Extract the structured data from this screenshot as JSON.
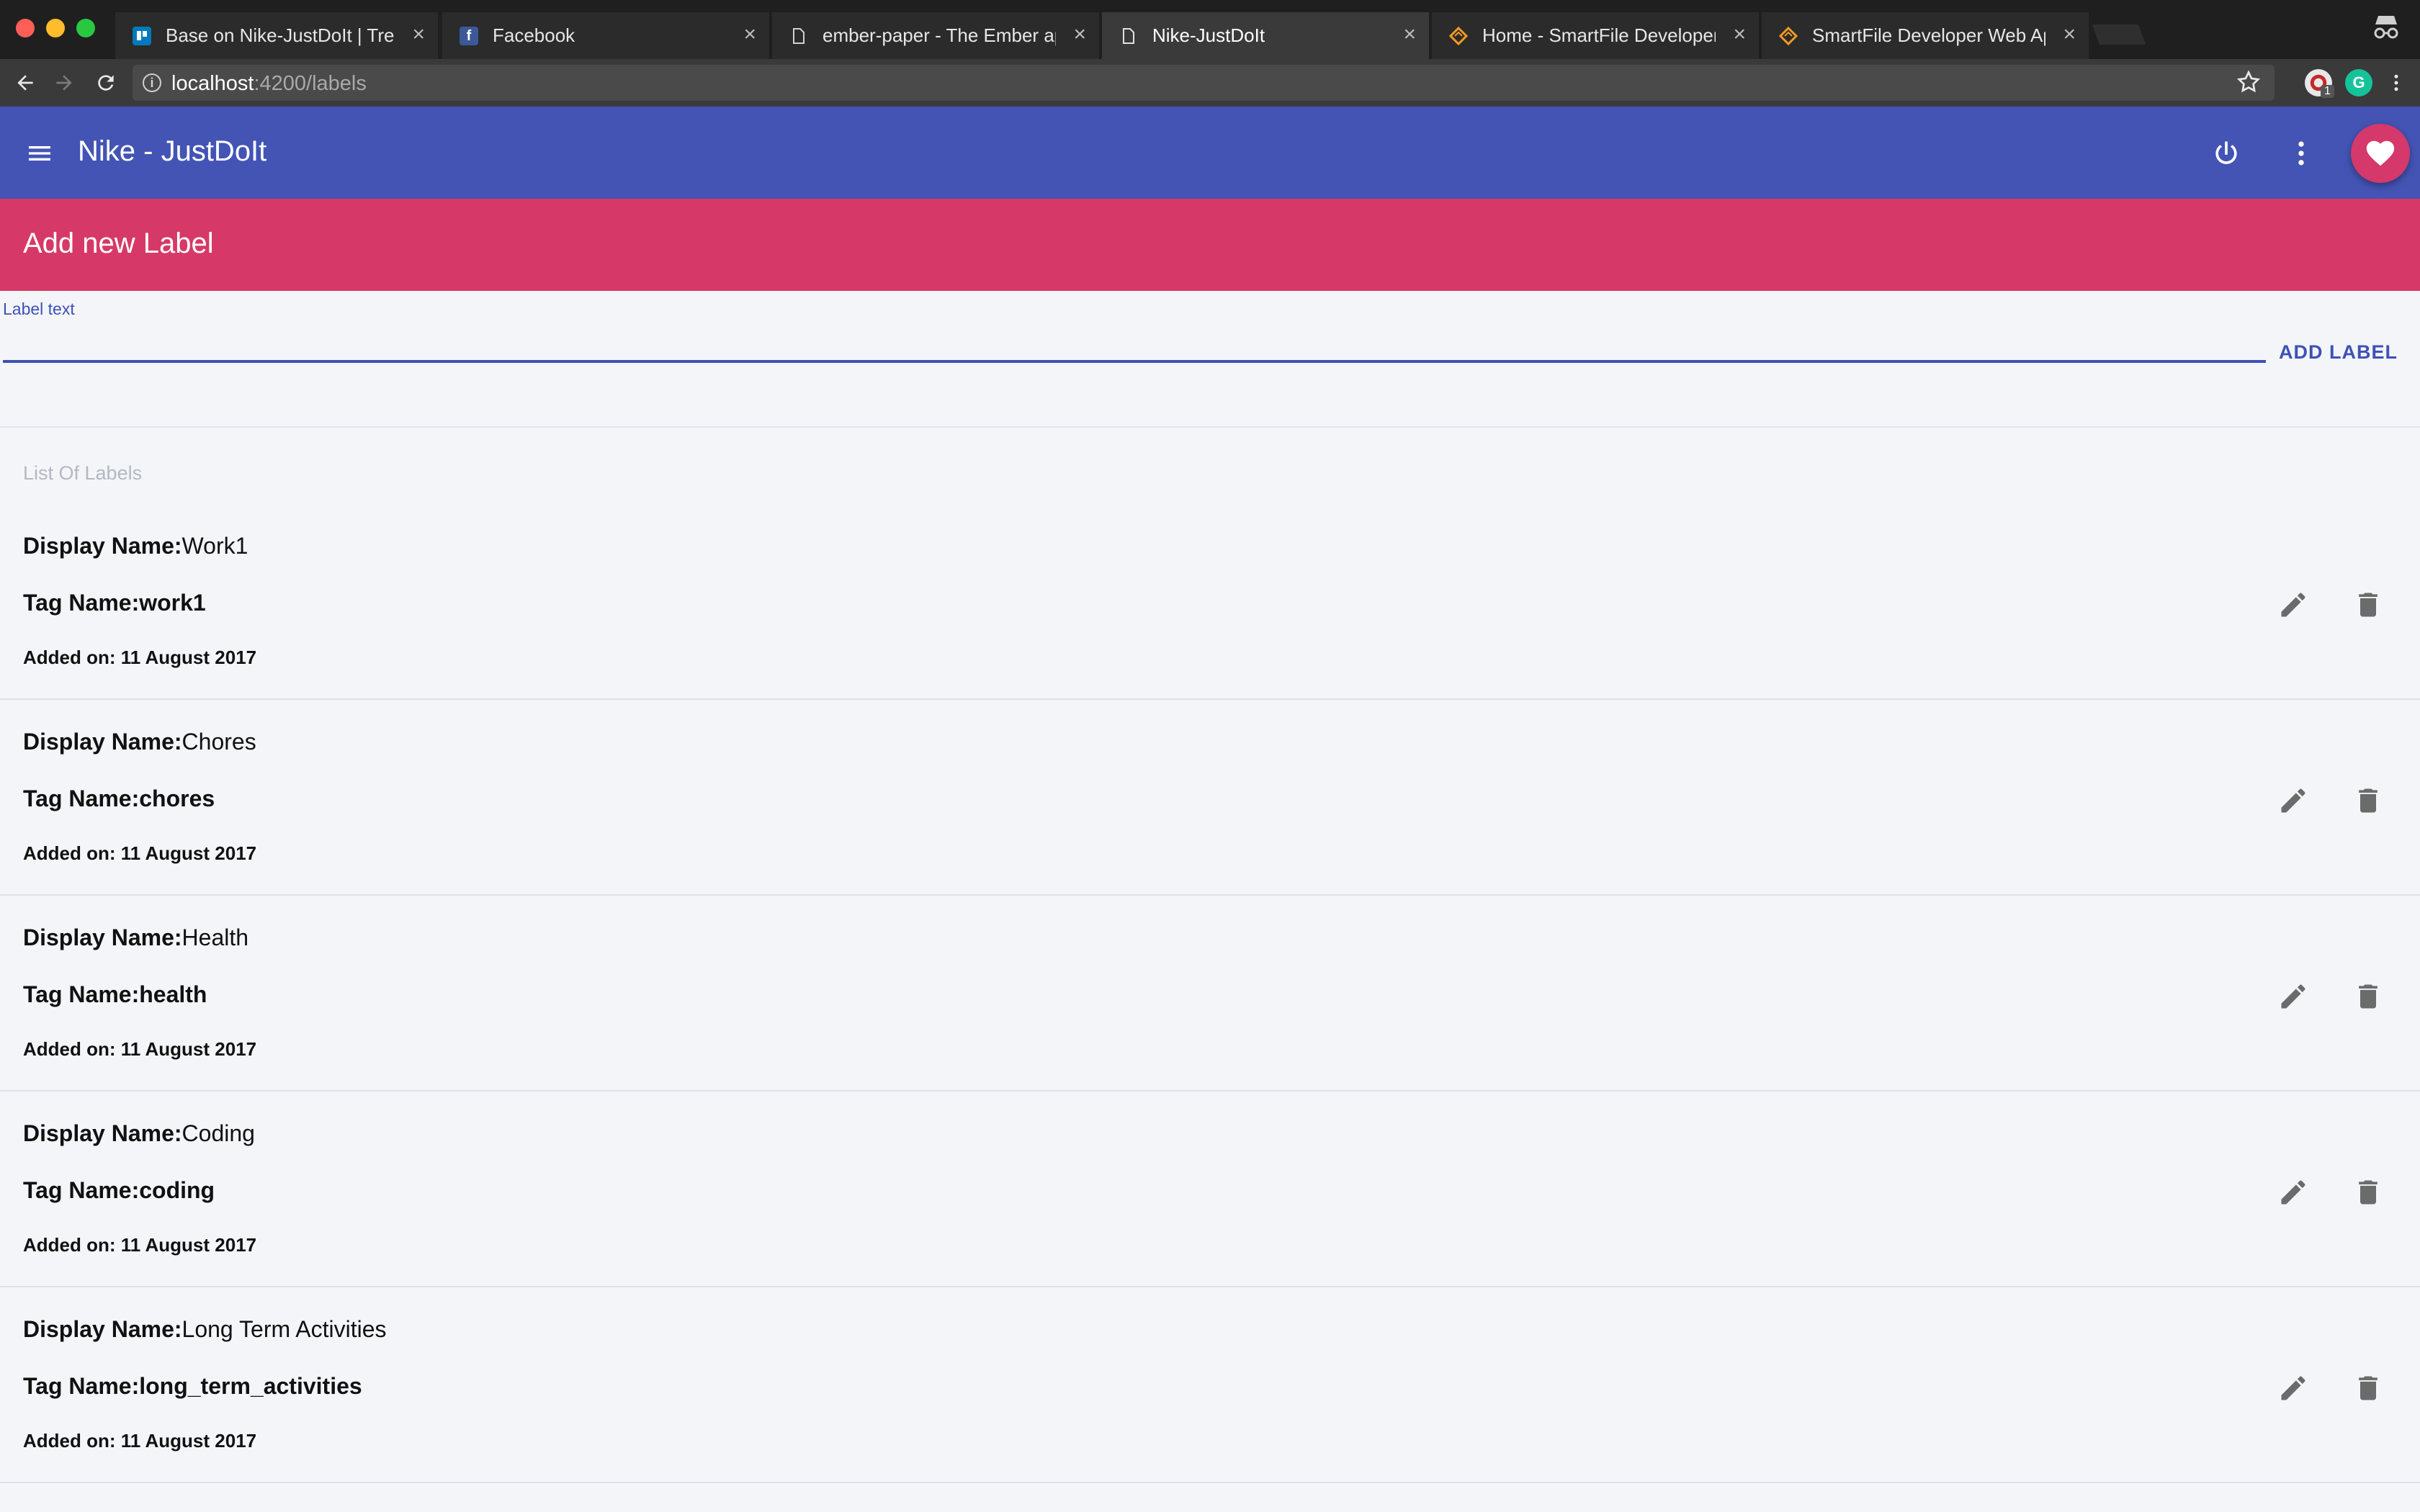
{
  "browser": {
    "tabs": [
      {
        "title": "Base on Nike-JustDoIt | Trello",
        "icon": "trello-icon",
        "active": false
      },
      {
        "title": "Facebook",
        "icon": "facebook-icon",
        "active": false
      },
      {
        "title": "ember-paper - The Ember app",
        "icon": "page-icon",
        "active": false
      },
      {
        "title": "Nike-JustDoIt",
        "icon": "page-icon",
        "active": true
      },
      {
        "title": "Home - SmartFile Developers",
        "icon": "smartfile-icon",
        "active": false
      },
      {
        "title": "SmartFile Developer Web App",
        "icon": "smartfile-icon",
        "active": false
      }
    ],
    "url_host": "localhost",
    "url_path": ":4200/labels",
    "extension_badge": "1",
    "grammarly_letter": "G"
  },
  "app": {
    "title": "Nike - JustDoIt",
    "accent": "#4354b5",
    "pink": "#d63967"
  },
  "form": {
    "banner_title": "Add new Label",
    "field_label": "Label text",
    "field_value": "",
    "add_button": "ADD LABEL"
  },
  "list": {
    "header": "List Of Labels",
    "display_prefix": "Display Name:",
    "tag_prefix": "Tag Name:",
    "date_prefix": "Added on: ",
    "items": [
      {
        "display": "Work1",
        "tag": "work1",
        "date": "11 August 2017"
      },
      {
        "display": "Chores",
        "tag": "chores",
        "date": "11 August 2017"
      },
      {
        "display": "Health",
        "tag": "health",
        "date": "11 August 2017"
      },
      {
        "display": "Coding",
        "tag": "coding",
        "date": "11 August 2017"
      },
      {
        "display": "Long Term Activities",
        "tag": "long_term_activities",
        "date": "11 August 2017"
      }
    ]
  }
}
